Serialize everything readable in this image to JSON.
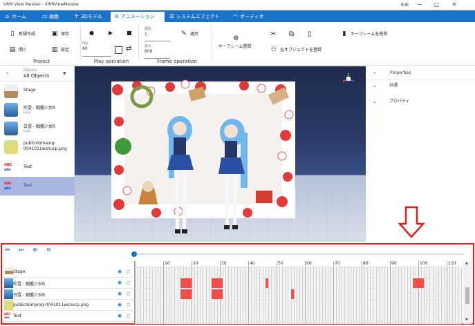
{
  "window": {
    "title": "VRM View Meister - VRMViewMeister",
    "user": "ゆあ"
  },
  "menu": {
    "tabs": [
      {
        "label": "ホーム",
        "icon": "home-icon"
      },
      {
        "label": "画面",
        "icon": "screen-icon"
      },
      {
        "label": "3Dモデル",
        "icon": "person-icon"
      },
      {
        "label": "アニメーション",
        "icon": "animation-icon",
        "active": true
      },
      {
        "label": "システムエフェクト",
        "icon": "effect-icon"
      },
      {
        "label": "オーディオ",
        "icon": "headphones-icon"
      }
    ]
  },
  "ribbon": {
    "project": {
      "label": "Project",
      "new": "新規作成",
      "save": "保存",
      "open": "開く",
      "settings": "設定"
    },
    "play": {
      "label": "Play operation",
      "fps_label": "Fps",
      "fps_value": "60"
    },
    "frame": {
      "label": "Frame operation",
      "start_label": "開始",
      "start_value": "1",
      "end_label": "最大",
      "end_value": "600",
      "apply": "適用"
    },
    "keyframe": {
      "register": "キーフレーム登録",
      "delete": "キーフレームを削除",
      "all_register": "全オブジェクトを登録"
    }
  },
  "objects": {
    "header_small": "Objects",
    "selected": "All Objects",
    "items": [
      {
        "name": "Stage",
        "sub": "",
        "kind": "stage"
      },
      {
        "name": "吹雪 - 戦艦少女R",
        "sub": "Lucia",
        "kind": "avatar"
      },
      {
        "name": "白雪 - 戦艦少女R",
        "sub": "Lucia",
        "kind": "avatar"
      },
      {
        "name": "publicdomainq-0041011wsnucp.png",
        "sub": "",
        "kind": "image"
      },
      {
        "name": "Text",
        "sub": "",
        "kind": "text"
      },
      {
        "name": "Text",
        "sub": "",
        "kind": "text",
        "selected": true
      }
    ]
  },
  "properties": {
    "title": "Properties",
    "sections": [
      "共通",
      "プロパティ"
    ]
  },
  "timeline": {
    "rows": [
      "Stage",
      "吹雪 - 戦艦少女R",
      "白雪 - 戦艦少女R",
      "publicdomainq-0041011wsnucp.png",
      "Text"
    ],
    "frame_labels": [
      "10",
      "20",
      "30",
      "40",
      "50",
      "60",
      "70",
      "80",
      "90",
      "100",
      "110"
    ]
  },
  "colors": {
    "accent": "#1a73c8",
    "highlight": "#e01e1e",
    "keyframe": "#f44b4b",
    "selected_row": "#a9b6e2"
  }
}
